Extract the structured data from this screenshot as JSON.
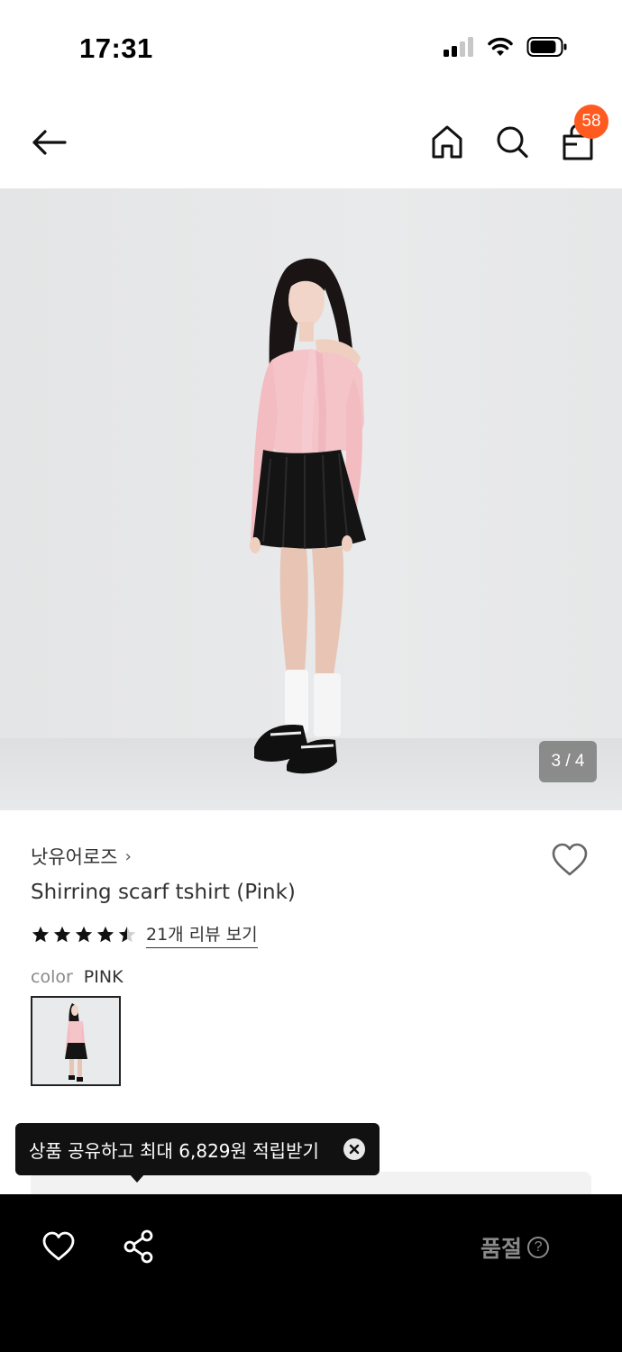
{
  "status": {
    "time": "17:31"
  },
  "nav": {
    "cart_count": "58"
  },
  "hero": {
    "counter": "3 / 4"
  },
  "product": {
    "brand": "낫유어로즈",
    "brand_chevron": "›",
    "name": "Shirring scarf tshirt (Pink)",
    "rating": 4.5,
    "review_link": "21개 리뷰 보기",
    "color_label": "color",
    "color_value": "PINK"
  },
  "tooltip": {
    "text": "상품 공유하고 최대 6,829원 적립받기"
  },
  "bottom_bar": {
    "soldout_label": "품절",
    "help_glyph": "?"
  },
  "colors": {
    "accent_badge": "#ff5a1f",
    "top_pink": "#f4c4c8",
    "skirt": "#141414"
  },
  "icons": [
    "back-arrow-icon",
    "home-icon",
    "search-icon",
    "shopping-bag-icon",
    "heart-icon",
    "star-icon",
    "close-icon",
    "share-icon",
    "help-icon",
    "signal-icon",
    "wifi-icon",
    "battery-icon"
  ]
}
